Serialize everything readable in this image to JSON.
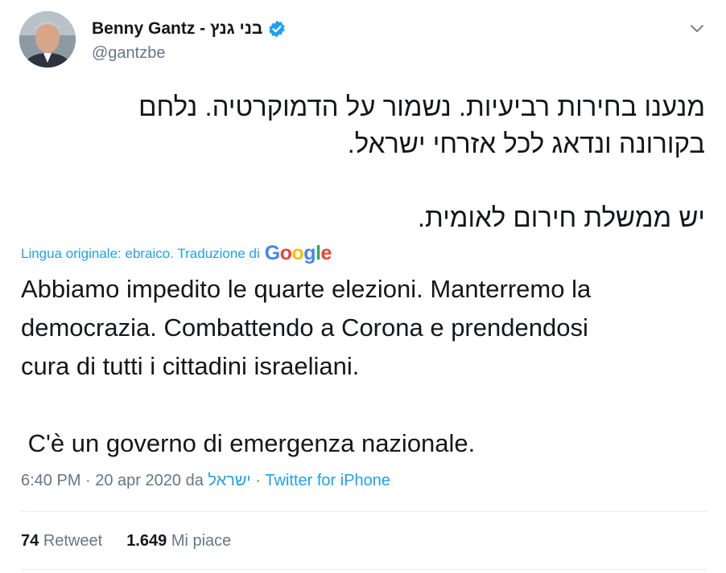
{
  "author": {
    "display_name": "Benny Gantz - בני גנץ",
    "handle": "@gantzbe",
    "verified": true,
    "avatar_icon": "profile-photo"
  },
  "icons": {
    "menu": "chevron-down-icon",
    "verified": "verified-badge-icon"
  },
  "colors": {
    "link": "#1da1f2",
    "secondary_text": "#657786",
    "primary_text": "#14171a"
  },
  "tweet": {
    "original_line1": "מנענו בחירות רביעיות. נשמור על הדמוקרטיה. נלחם",
    "original_line2": "בקורונה ונדאג לכל אזרחי ישראל.",
    "original_line3": "יש ממשלת חירום לאומית.",
    "translation_note": "Lingua originale: ebraico. Traduzione di",
    "translation_provider": "Google",
    "translated_line1": "Abbiamo impedito le quarte elezioni. Manterremo la",
    "translated_line2": "democrazia. Combattendo a Corona e prendendosi",
    "translated_line3": "cura di tutti i cittadini israeliani.",
    "translated_line4": " C'è un governo di emergenza nazionale."
  },
  "meta": {
    "timestamp": "6:40 PM · 20 apr 2020 da",
    "location": "ישראל",
    "separator": "·",
    "source": "Twitter for iPhone"
  },
  "stats": {
    "retweets_count": "74",
    "retweets_label": "Retweet",
    "likes_count": "1.649",
    "likes_label": "Mi piace"
  }
}
